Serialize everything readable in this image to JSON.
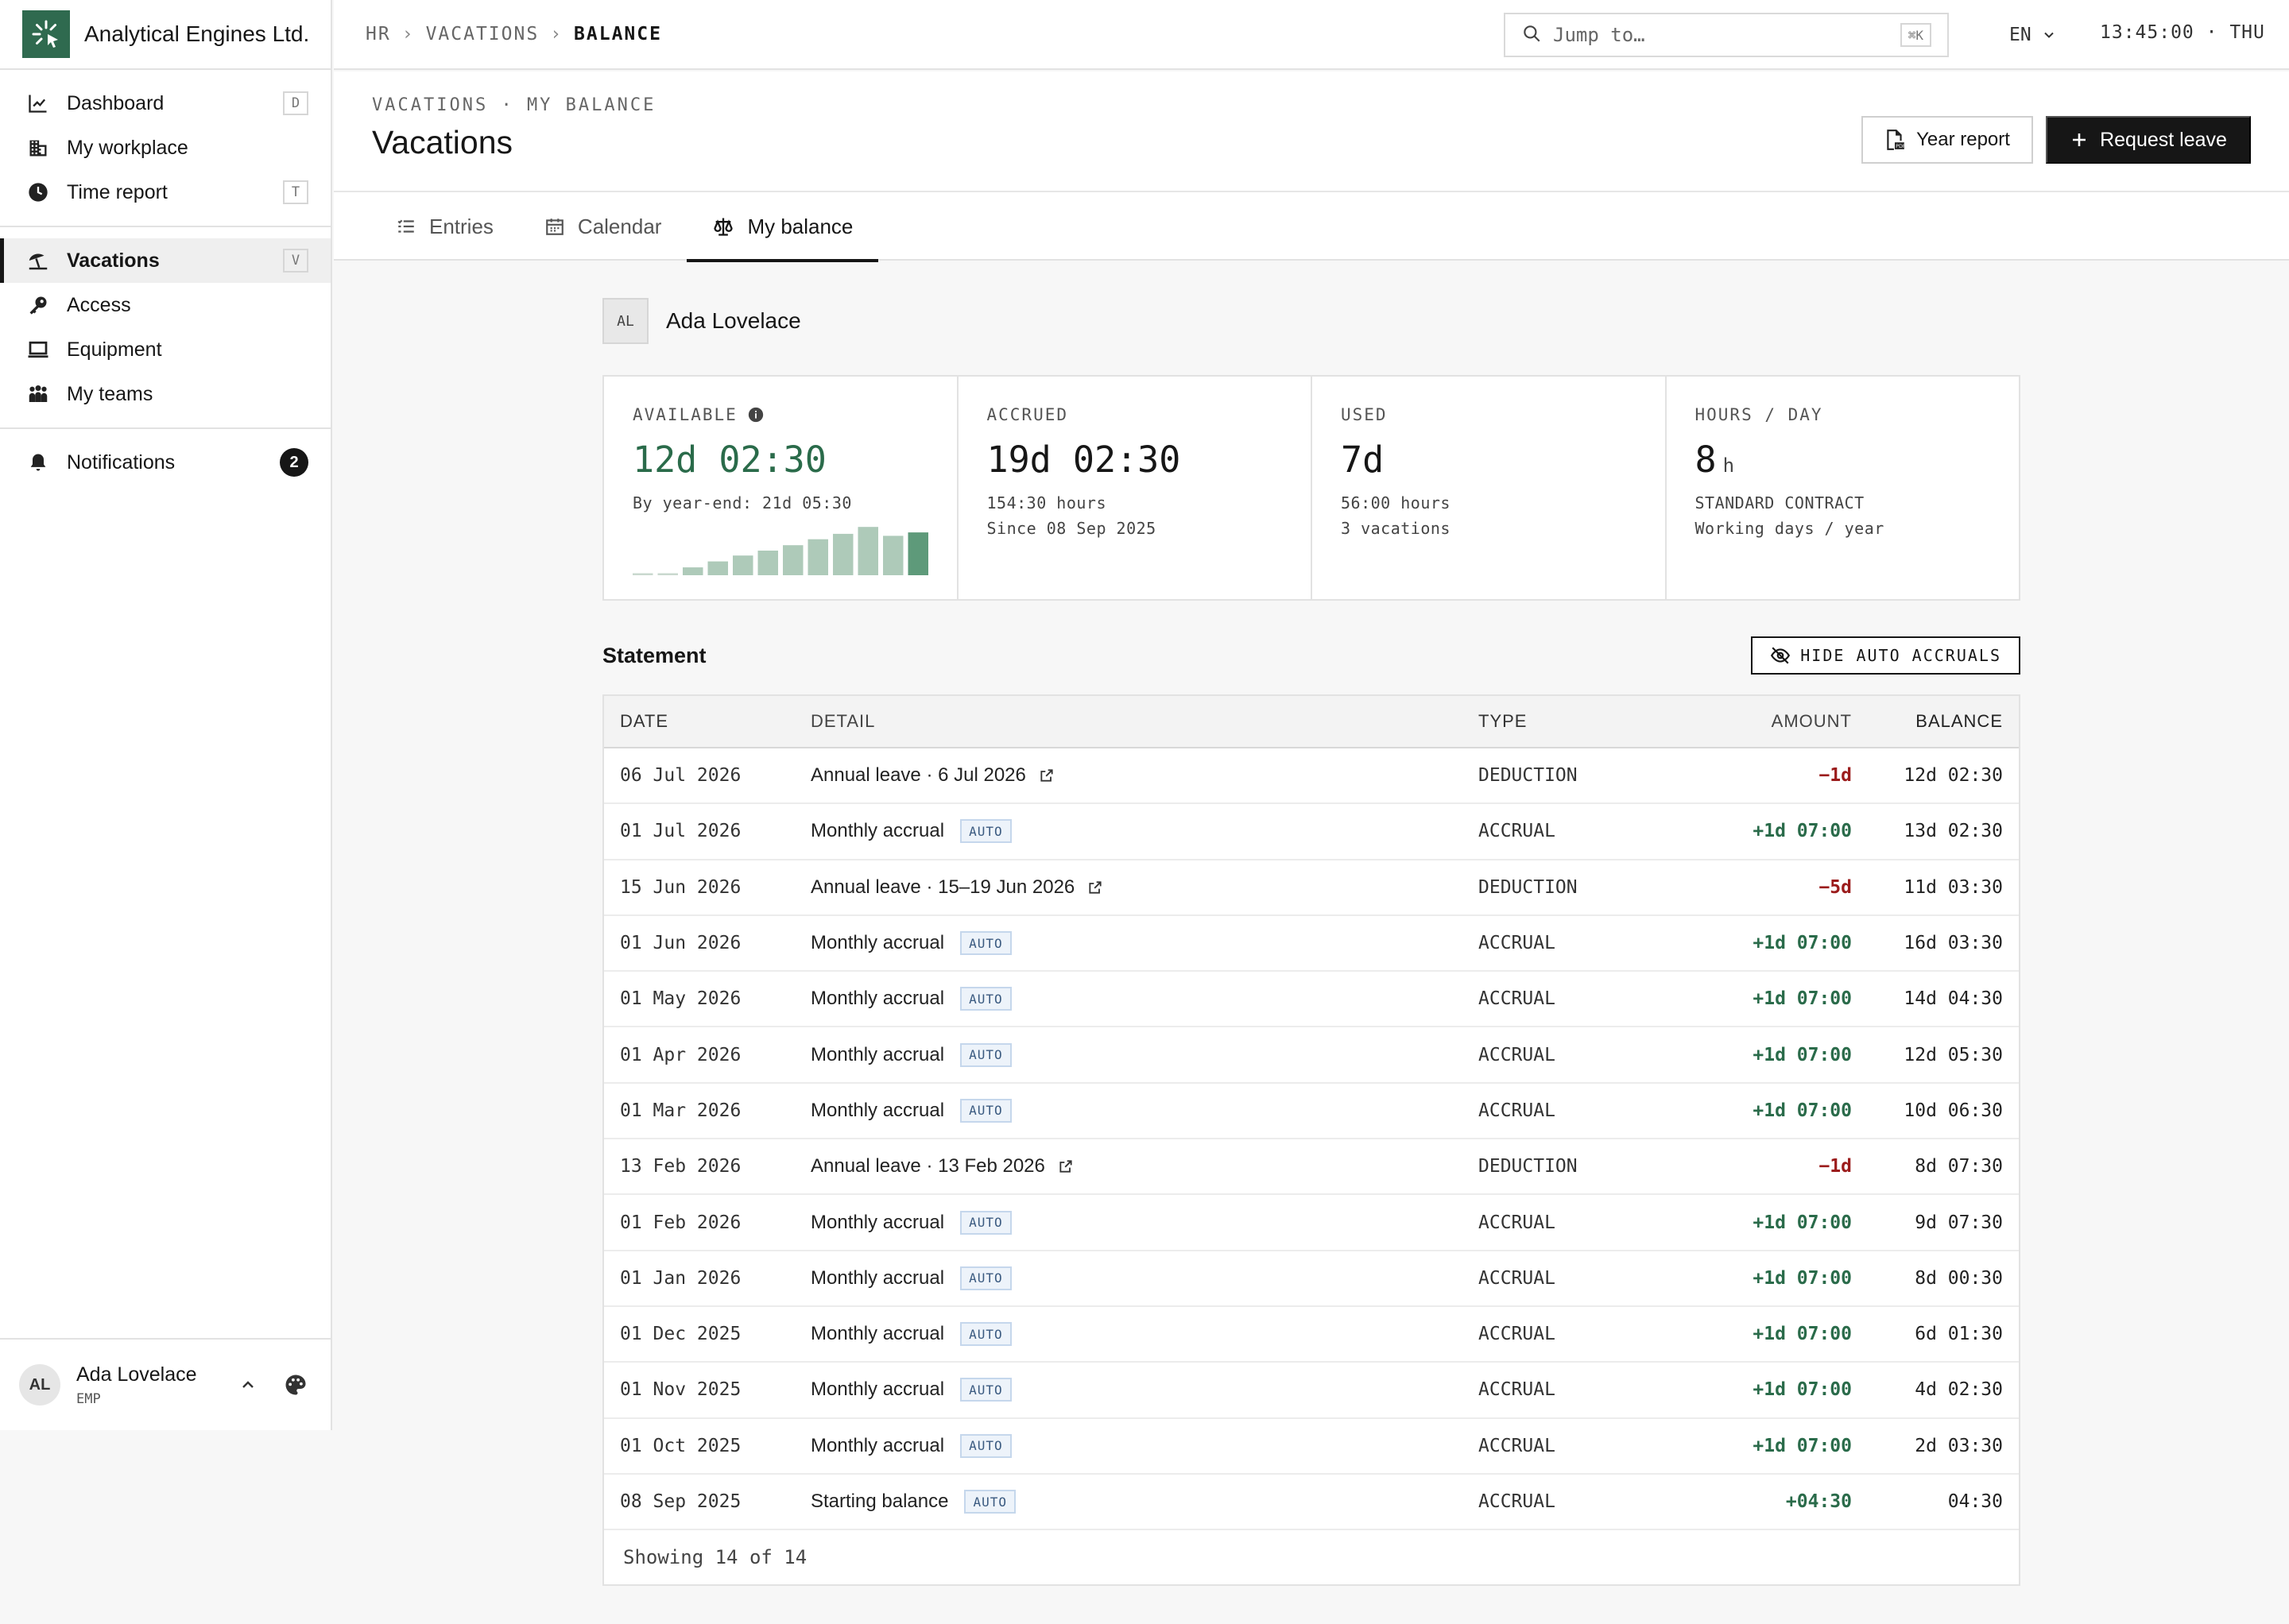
{
  "brand": {
    "name": "Analytical Engines Ltd."
  },
  "sidebar": {
    "groups": [
      [
        {
          "label": "Dashboard",
          "icon": "chart-line-icon",
          "shortcut": "D"
        },
        {
          "label": "My workplace",
          "icon": "building-icon",
          "shortcut": ""
        },
        {
          "label": "Time report",
          "icon": "clock-icon",
          "shortcut": "T"
        }
      ],
      [
        {
          "label": "Vacations",
          "icon": "beach-umbrella-icon",
          "shortcut": "V",
          "active": true
        },
        {
          "label": "Access",
          "icon": "key-icon",
          "shortcut": ""
        },
        {
          "label": "Equipment",
          "icon": "laptop-icon",
          "shortcut": ""
        },
        {
          "label": "My teams",
          "icon": "people-icon",
          "shortcut": ""
        }
      ],
      [
        {
          "label": "Notifications",
          "icon": "bell-icon",
          "badge": "2"
        }
      ]
    ],
    "user": {
      "initials": "AL",
      "name": "Ada Lovelace",
      "role": "EMP"
    }
  },
  "topbar": {
    "breadcrumb": [
      "HR",
      "VACATIONS",
      "BALANCE"
    ],
    "search_placeholder": "Jump to…",
    "search_shortcut": "⌘K",
    "language": "EN",
    "clock": "13:45:00 · THU"
  },
  "header": {
    "eyebrow": "VACATIONS · MY BALANCE",
    "title": "Vacations",
    "year_report_label": "Year report",
    "request_leave_label": "Request leave"
  },
  "tabs": [
    {
      "label": "Entries",
      "icon": "list-icon"
    },
    {
      "label": "Calendar",
      "icon": "calendar-icon"
    },
    {
      "label": "My balance",
      "icon": "scale-icon",
      "active": true
    }
  ],
  "employee": {
    "initials": "AL",
    "name": "Ada Lovelace"
  },
  "cards": {
    "available": {
      "label": "AVAILABLE",
      "value": "12d 02:30",
      "sub": "By year-end: 21d 05:30"
    },
    "accrued": {
      "label": "ACCRUED",
      "value": "19d 02:30",
      "sub1": "154:30 hours",
      "sub2": "Since 08 Sep 2025"
    },
    "used": {
      "label": "USED",
      "value": "7d",
      "sub1": "56:00 hours",
      "sub2": "3 vacations"
    },
    "hours_per_day": {
      "label": "HOURS / DAY",
      "value": "8",
      "unit": "h",
      "sub1": "STANDARD CONTRACT",
      "sub2": "Working days / year"
    }
  },
  "chart_data": {
    "type": "bar",
    "values": [
      0.04,
      0.04,
      0.16,
      0.28,
      0.4,
      0.5,
      0.61,
      0.73,
      0.84,
      0.98,
      0.8,
      0.87
    ],
    "highlight_last": true,
    "colors": {
      "bar": "#aecab9",
      "highlight": "#5e9a7a",
      "baseline": "#c9d9cf"
    }
  },
  "statement": {
    "title": "Statement",
    "hide_auto_label": "HIDE AUTO ACCRUALS",
    "columns": [
      "DATE",
      "DETAIL",
      "TYPE",
      "AMOUNT",
      "BALANCE"
    ],
    "rows": [
      {
        "date": "06 Jul 2026",
        "detail": "Annual leave · 6 Jul 2026",
        "link": true,
        "type": "DEDUCTION",
        "amount": "−1d",
        "sign": "neg",
        "balance": "12d 02:30"
      },
      {
        "date": "01 Jul 2026",
        "detail": "Monthly accrual",
        "auto": "AUTO",
        "type": "ACCRUAL",
        "amount": "+1d 07:00",
        "sign": "pos",
        "balance": "13d 02:30"
      },
      {
        "date": "15 Jun 2026",
        "detail": "Annual leave · 15–19 Jun 2026",
        "link": true,
        "type": "DEDUCTION",
        "amount": "−5d",
        "sign": "neg",
        "balance": "11d 03:30"
      },
      {
        "date": "01 Jun 2026",
        "detail": "Monthly accrual",
        "auto": "AUTO",
        "type": "ACCRUAL",
        "amount": "+1d 07:00",
        "sign": "pos",
        "balance": "16d 03:30"
      },
      {
        "date": "01 May 2026",
        "detail": "Monthly accrual",
        "auto": "AUTO",
        "type": "ACCRUAL",
        "amount": "+1d 07:00",
        "sign": "pos",
        "balance": "14d 04:30"
      },
      {
        "date": "01 Apr 2026",
        "detail": "Monthly accrual",
        "auto": "AUTO",
        "type": "ACCRUAL",
        "amount": "+1d 07:00",
        "sign": "pos",
        "balance": "12d 05:30"
      },
      {
        "date": "01 Mar 2026",
        "detail": "Monthly accrual",
        "auto": "AUTO",
        "type": "ACCRUAL",
        "amount": "+1d 07:00",
        "sign": "pos",
        "balance": "10d 06:30"
      },
      {
        "date": "13 Feb 2026",
        "detail": "Annual leave · 13 Feb 2026",
        "link": true,
        "type": "DEDUCTION",
        "amount": "−1d",
        "sign": "neg",
        "balance": "8d 07:30"
      },
      {
        "date": "01 Feb 2026",
        "detail": "Monthly accrual",
        "auto": "AUTO",
        "type": "ACCRUAL",
        "amount": "+1d 07:00",
        "sign": "pos",
        "balance": "9d 07:30"
      },
      {
        "date": "01 Jan 2026",
        "detail": "Monthly accrual",
        "auto": "AUTO",
        "type": "ACCRUAL",
        "amount": "+1d 07:00",
        "sign": "pos",
        "balance": "8d 00:30"
      },
      {
        "date": "01 Dec 2025",
        "detail": "Monthly accrual",
        "auto": "AUTO",
        "type": "ACCRUAL",
        "amount": "+1d 07:00",
        "sign": "pos",
        "balance": "6d 01:30"
      },
      {
        "date": "01 Nov 2025",
        "detail": "Monthly accrual",
        "auto": "AUTO",
        "type": "ACCRUAL",
        "amount": "+1d 07:00",
        "sign": "pos",
        "balance": "4d 02:30"
      },
      {
        "date": "01 Oct 2025",
        "detail": "Monthly accrual",
        "auto": "AUTO",
        "type": "ACCRUAL",
        "amount": "+1d 07:00",
        "sign": "pos",
        "balance": "2d 03:30"
      },
      {
        "date": "08 Sep 2025",
        "detail": "Starting balance",
        "auto": "AUTO",
        "type": "ACCRUAL",
        "amount": "+04:30",
        "sign": "pos",
        "balance": "04:30"
      }
    ],
    "footer": "Showing 14 of 14"
  }
}
